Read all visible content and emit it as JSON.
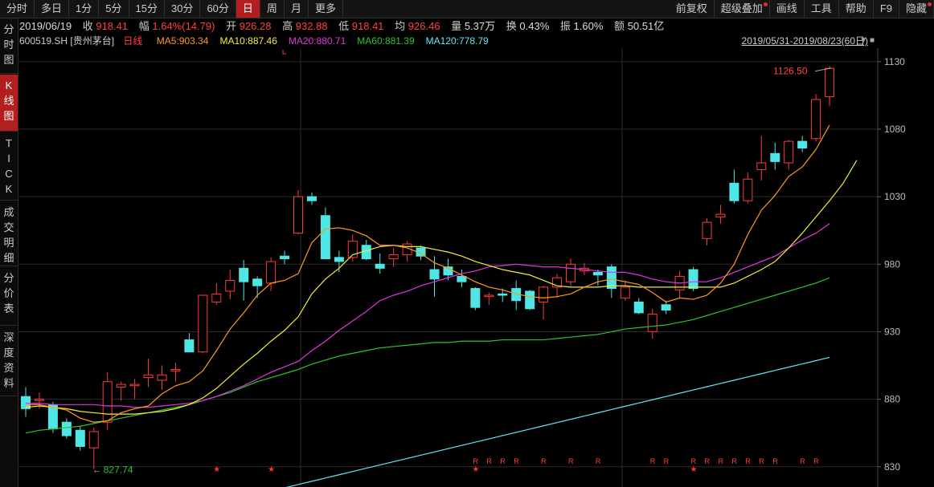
{
  "toolbar": {
    "left": [
      {
        "label": "分时",
        "name": "tab-intraday"
      },
      {
        "label": "多日",
        "name": "tab-multiday"
      },
      {
        "label": "1分",
        "name": "tab-1min"
      },
      {
        "label": "5分",
        "name": "tab-5min"
      },
      {
        "label": "15分",
        "name": "tab-15min"
      },
      {
        "label": "30分",
        "name": "tab-30min"
      },
      {
        "label": "60分",
        "name": "tab-60min"
      },
      {
        "label": "日",
        "name": "tab-daily",
        "active": true
      },
      {
        "label": "周",
        "name": "tab-weekly"
      },
      {
        "label": "月",
        "name": "tab-monthly"
      },
      {
        "label": "更多",
        "name": "tab-more"
      }
    ],
    "right": [
      {
        "label": "前复权",
        "name": "button-forward-adjust"
      },
      {
        "label": "超级叠加",
        "name": "button-super-overlay",
        "dot": true
      },
      {
        "label": "画线",
        "name": "button-draw-line"
      },
      {
        "label": "工具",
        "name": "button-tools"
      },
      {
        "label": "帮助",
        "name": "button-help"
      },
      {
        "label": "F9",
        "name": "button-f9"
      },
      {
        "label": "隐藏",
        "name": "button-hide",
        "dot": true
      }
    ]
  },
  "sidebar": [
    {
      "label": "分时图",
      "name": "side-tab-intraday-chart",
      "active": false,
      "h": 70
    },
    {
      "label": "K线图",
      "name": "side-tab-kline-chart",
      "active": true,
      "h": 72
    },
    {
      "label": "TICK",
      "name": "side-tab-tick",
      "active": false,
      "h": 86
    },
    {
      "label": "成交明细",
      "name": "side-tab-trade-detail",
      "active": false,
      "h": 82
    },
    {
      "label": "分价表",
      "name": "side-tab-price-table",
      "active": false,
      "h": 74
    },
    {
      "label": "深度资料",
      "name": "side-tab-deep-data",
      "active": false,
      "h": 88
    }
  ],
  "info": {
    "date": "2019/06/19",
    "close_label": "收",
    "close": "918.41",
    "change_label": "幅",
    "change": "1.64%(14.79)",
    "open_label": "开",
    "open": "926.28",
    "high_label": "高",
    "high": "932.88",
    "low_label": "低",
    "low": "918.41",
    "avg_label": "均",
    "avg": "926.46",
    "volume_label": "量",
    "volume": "5.37万",
    "turnover_label": "换",
    "turnover": "0.43%",
    "amplitude_label": "振",
    "amplitude": "1.60%",
    "amount_label": "额",
    "amount": "50.51亿"
  },
  "legend": {
    "symbol": "600519.SH [贵州茅台]",
    "period": "日线",
    "ma": [
      {
        "label": "MA5:903.34",
        "color": "#ff9a1a"
      },
      {
        "label": "MA10:887.46",
        "color": "#f2ee33"
      },
      {
        "label": "MA20:880.71",
        "color": "#e235e2"
      },
      {
        "label": "MA60:881.39",
        "color": "#2fc22f"
      },
      {
        "label": "MA120:778.79",
        "color": "#5ce8f8"
      }
    ],
    "range": "2019/05/31-2019/08/23(60日)"
  },
  "colors": {
    "up": "#ff3b3b",
    "down": "#4fe6e6",
    "grid": "#2b2b2b",
    "axis_text": "#bdbdbd"
  },
  "chart_data": {
    "type": "candlestick",
    "ylim": [
      815,
      1140
    ],
    "y_ticks": [
      "1130",
      "1080",
      "1030",
      "980",
      "930",
      "880",
      "830"
    ],
    "y_tick_values": [
      1130,
      1080,
      1030,
      980,
      930,
      880,
      830
    ],
    "high_label": "1126.50",
    "low_label": "827.74",
    "candles": [
      {
        "o": 882,
        "c": 873,
        "h": 889,
        "l": 867
      },
      {
        "o": 879,
        "c": 880,
        "h": 885,
        "l": 873
      },
      {
        "o": 876,
        "c": 858,
        "h": 878,
        "l": 855
      },
      {
        "o": 863,
        "c": 853,
        "h": 866,
        "l": 851
      },
      {
        "o": 857,
        "c": 845,
        "h": 860,
        "l": 842
      },
      {
        "o": 844,
        "c": 856,
        "h": 859,
        "l": 828
      },
      {
        "o": 863,
        "c": 893,
        "h": 900,
        "l": 857
      },
      {
        "o": 889,
        "c": 891,
        "h": 893,
        "l": 879
      },
      {
        "o": 890,
        "c": 891,
        "h": 895,
        "l": 880
      },
      {
        "o": 896,
        "c": 898,
        "h": 910,
        "l": 889
      },
      {
        "o": 894,
        "c": 898,
        "h": 905,
        "l": 887
      },
      {
        "o": 901,
        "c": 902,
        "h": 907,
        "l": 893
      },
      {
        "o": 924,
        "c": 915,
        "h": 929,
        "l": 915
      },
      {
        "o": 915,
        "c": 957,
        "h": 957,
        "l": 914
      },
      {
        "o": 952,
        "c": 958,
        "h": 966,
        "l": 950
      },
      {
        "o": 960,
        "c": 968,
        "h": 976,
        "l": 954
      },
      {
        "o": 977,
        "c": 967,
        "h": 983,
        "l": 953
      },
      {
        "o": 969,
        "c": 964,
        "h": 971,
        "l": 955
      },
      {
        "o": 966,
        "c": 982,
        "h": 985,
        "l": 960
      },
      {
        "o": 986,
        "c": 984,
        "h": 990,
        "l": 980
      },
      {
        "o": 1003,
        "c": 1030,
        "h": 1035,
        "l": 1002
      },
      {
        "o": 1030,
        "c": 1027,
        "h": 1033,
        "l": 1024
      },
      {
        "o": 1016,
        "c": 984,
        "h": 1022,
        "l": 984
      },
      {
        "o": 985,
        "c": 982,
        "h": 990,
        "l": 974
      },
      {
        "o": 985,
        "c": 997,
        "h": 1002,
        "l": 982
      },
      {
        "o": 994,
        "c": 984,
        "h": 998,
        "l": 983
      },
      {
        "o": 980,
        "c": 977,
        "h": 988,
        "l": 973
      },
      {
        "o": 984,
        "c": 987,
        "h": 992,
        "l": 978
      },
      {
        "o": 987,
        "c": 995,
        "h": 997,
        "l": 982
      },
      {
        "o": 992,
        "c": 986,
        "h": 994,
        "l": 983
      },
      {
        "o": 976,
        "c": 969,
        "h": 986,
        "l": 956
      },
      {
        "o": 978,
        "c": 972,
        "h": 984,
        "l": 968
      },
      {
        "o": 971,
        "c": 967,
        "h": 976,
        "l": 963
      },
      {
        "o": 962,
        "c": 948,
        "h": 963,
        "l": 946
      },
      {
        "o": 956,
        "c": 957,
        "h": 959,
        "l": 950
      },
      {
        "o": 958,
        "c": 957,
        "h": 962,
        "l": 952
      },
      {
        "o": 962,
        "c": 953,
        "h": 968,
        "l": 946
      },
      {
        "o": 960,
        "c": 947,
        "h": 961,
        "l": 946
      },
      {
        "o": 952,
        "c": 963,
        "h": 964,
        "l": 939
      },
      {
        "o": 963,
        "c": 970,
        "h": 973,
        "l": 955
      },
      {
        "o": 967,
        "c": 980,
        "h": 984,
        "l": 964
      },
      {
        "o": 975,
        "c": 977,
        "h": 981,
        "l": 972
      },
      {
        "o": 974,
        "c": 972,
        "h": 976,
        "l": 964
      },
      {
        "o": 978,
        "c": 962,
        "h": 980,
        "l": 955
      },
      {
        "o": 955,
        "c": 963,
        "h": 968,
        "l": 953
      },
      {
        "o": 952,
        "c": 944,
        "h": 955,
        "l": 943
      },
      {
        "o": 930,
        "c": 943,
        "h": 947,
        "l": 925
      },
      {
        "o": 950,
        "c": 946,
        "h": 953,
        "l": 943
      },
      {
        "o": 961,
        "c": 971,
        "h": 975,
        "l": 955
      },
      {
        "o": 976,
        "c": 962,
        "h": 978,
        "l": 960
      },
      {
        "o": 999,
        "c": 1011,
        "h": 1014,
        "l": 994
      },
      {
        "o": 1015,
        "c": 1017,
        "h": 1024,
        "l": 1010
      },
      {
        "o": 1040,
        "c": 1027,
        "h": 1050,
        "l": 1025
      },
      {
        "o": 1027,
        "c": 1043,
        "h": 1048,
        "l": 1025
      },
      {
        "o": 1050,
        "c": 1055,
        "h": 1075,
        "l": 1042
      },
      {
        "o": 1062,
        "c": 1056,
        "h": 1070,
        "l": 1050
      },
      {
        "o": 1055,
        "c": 1071,
        "h": 1072,
        "l": 1050
      },
      {
        "o": 1071,
        "c": 1066,
        "h": 1075,
        "l": 1063
      },
      {
        "o": 1073,
        "c": 1102,
        "h": 1106,
        "l": 1071
      },
      {
        "o": 1104,
        "c": 1125,
        "h": 1127,
        "l": 1097
      }
    ],
    "ma5": [
      876,
      876,
      874,
      872,
      866,
      863,
      864,
      870,
      873,
      875,
      884,
      890,
      893,
      901,
      916,
      932,
      944,
      957,
      966,
      968,
      973,
      996,
      1006,
      1007,
      1005,
      1001,
      994,
      994,
      992,
      988,
      981,
      977,
      972,
      967,
      963,
      961,
      958,
      956,
      955,
      956,
      958,
      963,
      967,
      969,
      967,
      965,
      959,
      952,
      955,
      954,
      957,
      966,
      980,
      1002,
      1020,
      1031,
      1045,
      1052,
      1065,
      1083
    ],
    "ma10": [
      874,
      875,
      874,
      873,
      871,
      870,
      869,
      869,
      869,
      870,
      871,
      873,
      876,
      881,
      888,
      897,
      906,
      914,
      923,
      931,
      941,
      958,
      969,
      977,
      987,
      990,
      993,
      994,
      993,
      993,
      991,
      989,
      986,
      982,
      979,
      976,
      974,
      972,
      968,
      964,
      963,
      963,
      963,
      964,
      964,
      963,
      963,
      963,
      963,
      963,
      963,
      963,
      966,
      971,
      976,
      982,
      992,
      1003,
      1015,
      1027,
      1040,
      1057
    ],
    "ma20": [
      877,
      877,
      876,
      876,
      876,
      876,
      875,
      875,
      874,
      874,
      875,
      876,
      877,
      879,
      882,
      886,
      890,
      895,
      900,
      904,
      908,
      916,
      923,
      931,
      938,
      945,
      953,
      957,
      960,
      964,
      967,
      970,
      973,
      975,
      978,
      979,
      980,
      979,
      978,
      978,
      977,
      976,
      975,
      974,
      974,
      972,
      969,
      967,
      966,
      967,
      967,
      970,
      974,
      978,
      982,
      986,
      992,
      998,
      1003,
      1010
    ],
    "ma60": [
      855,
      857,
      858,
      859,
      860,
      862,
      864,
      866,
      868,
      870,
      872,
      874,
      876,
      879,
      882,
      885,
      889,
      893,
      896,
      899,
      902,
      906,
      909,
      912,
      914,
      916,
      918,
      919,
      920,
      921,
      922,
      922,
      923,
      923,
      923,
      924,
      924,
      924,
      924,
      925,
      926,
      927,
      928,
      930,
      932,
      933,
      934,
      935,
      937,
      939,
      942,
      945,
      948,
      951,
      954,
      957,
      960,
      963,
      966,
      970
    ],
    "ma120": [],
    "r_markers": [
      33,
      34,
      35,
      36,
      38,
      40,
      42,
      46,
      47,
      49,
      50,
      51,
      52,
      53,
      54,
      55,
      57,
      58
    ],
    "star_markers": [
      14,
      18,
      33,
      49
    ]
  }
}
